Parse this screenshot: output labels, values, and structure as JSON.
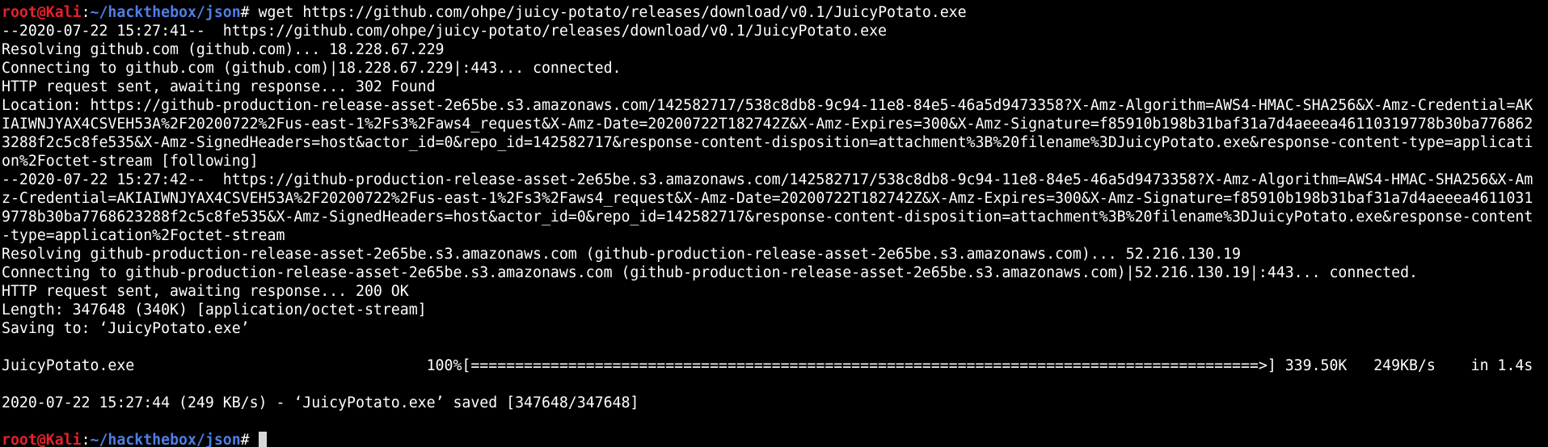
{
  "colors": {
    "background": "#000000",
    "foreground": "#ffffff",
    "prompt_user": "#e8202d",
    "prompt_path": "#4f7ee6"
  },
  "prompt": {
    "user": "root@Kali",
    "sep": ":",
    "path": "~/hackthebox/json",
    "symbol": "# "
  },
  "command": "wget https://github.com/ohpe/juicy-potato/releases/download/v0.1/JuicyPotato.exe",
  "output": {
    "l1": "--2020-07-22 15:27:41--  https://github.com/ohpe/juicy-potato/releases/download/v0.1/JuicyPotato.exe",
    "l2": "Resolving github.com (github.com)... 18.228.67.229",
    "l3": "Connecting to github.com (github.com)|18.228.67.229|:443... connected.",
    "l4": "HTTP request sent, awaiting response... 302 Found",
    "l5": "Location: https://github-production-release-asset-2e65be.s3.amazonaws.com/142582717/538c8db8-9c94-11e8-84e5-46a5d9473358?X-Amz-Algorithm=AWS4-HMAC-SHA256&X-Amz-Credential=AK",
    "l6": "IAIWNJYAX4CSVEH53A%2F20200722%2Fus-east-1%2Fs3%2Faws4_request&X-Amz-Date=20200722T182742Z&X-Amz-Expires=300&X-Amz-Signature=f85910b198b31baf31a7d4aeeea46110319778b30ba776862",
    "l7": "3288f2c5c8fe535&X-Amz-SignedHeaders=host&actor_id=0&repo_id=142582717&response-content-disposition=attachment%3B%20filename%3DJuicyPotato.exe&response-content-type=applicati",
    "l8": "on%2Foctet-stream [following]",
    "l9": "--2020-07-22 15:27:42--  https://github-production-release-asset-2e65be.s3.amazonaws.com/142582717/538c8db8-9c94-11e8-84e5-46a5d9473358?X-Amz-Algorithm=AWS4-HMAC-SHA256&X-Am",
    "l10": "z-Credential=AKIAIWNJYAX4CSVEH53A%2F20200722%2Fus-east-1%2Fs3%2Faws4_request&X-Amz-Date=20200722T182742Z&X-Amz-Expires=300&X-Amz-Signature=f85910b198b31baf31a7d4aeeea4611031",
    "l11": "9778b30ba7768623288f2c5c8fe535&X-Amz-SignedHeaders=host&actor_id=0&repo_id=142582717&response-content-disposition=attachment%3B%20filename%3DJuicyPotato.exe&response-content",
    "l12": "-type=application%2Foctet-stream",
    "l13": "Resolving github-production-release-asset-2e65be.s3.amazonaws.com (github-production-release-asset-2e65be.s3.amazonaws.com)... 52.216.130.19",
    "l14": "Connecting to github-production-release-asset-2e65be.s3.amazonaws.com (github-production-release-asset-2e65be.s3.amazonaws.com)|52.216.130.19|:443... connected.",
    "l15": "HTTP request sent, awaiting response... 200 OK",
    "l16": "Length: 347648 (340K) [application/octet-stream]",
    "l17": "Saving to: ‘JuicyPotato.exe’",
    "l18": "JuicyPotato.exe                                 100%[=========================================================================================>] 339.50K   249KB/s    in 1.4s",
    "l19": "2020-07-22 15:27:44 (249 KB/s) - ‘JuicyPotato.exe’ saved [347648/347648]"
  }
}
